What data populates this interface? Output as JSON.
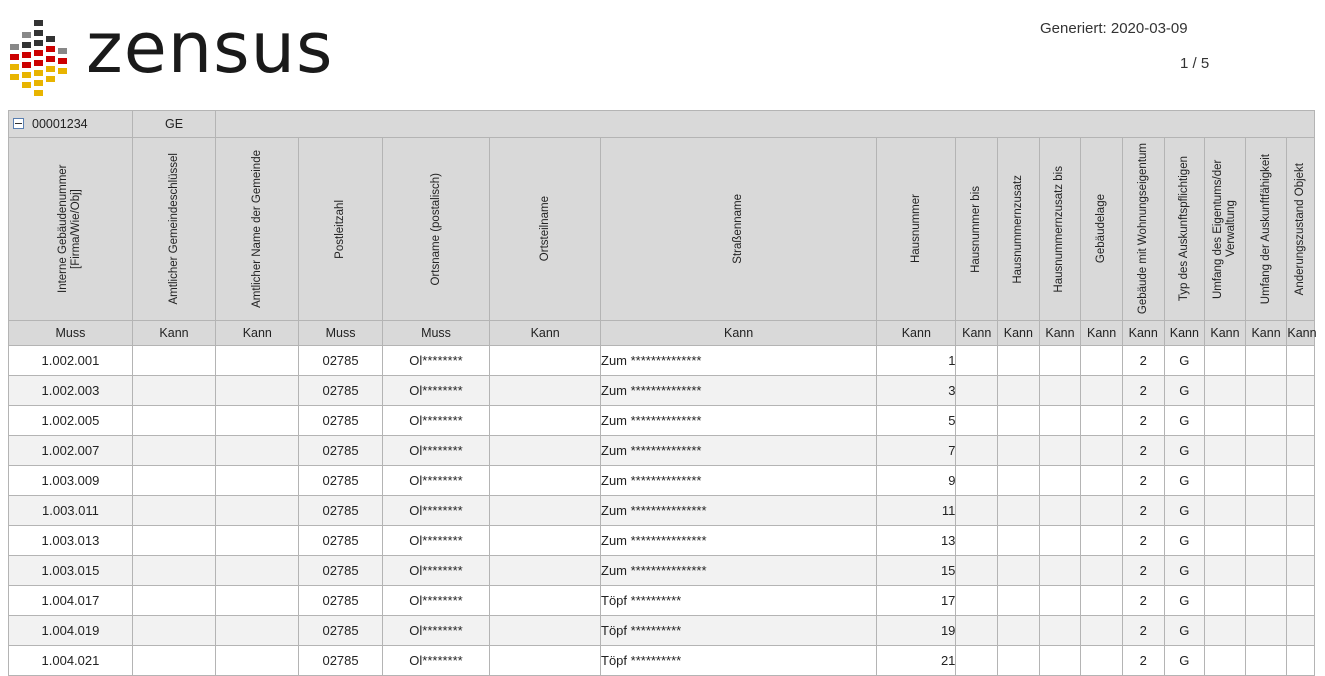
{
  "logo": {
    "word": "zensus"
  },
  "meta": {
    "generated": "Generiert: 2020-03-09",
    "page": "1 / 5"
  },
  "record": {
    "id": "00001234",
    "type": "GE"
  },
  "columns": [
    "Interne Gebäudenummer [Firma/Wie/Obj]",
    "Amtlicher Gemeindeschlüssel",
    "Amtlicher Name der Gemeinde",
    "Postleitzahl",
    "Ortsname (postalisch)",
    "Ortsteilname",
    "Straßenname",
    "Hausnummer",
    "Hausnummer bis",
    "Hausnummernzusatz",
    "Hausnummernzusatz bis",
    "Gebäudelage",
    "Gebäude mit Wohnungseigentum",
    "Typ des Auskunftspflichtigen",
    "Umfang des Eigentums/der Verwaltung",
    "Umfang der Auskunftfähigkeit",
    "Änderungszustand Objekt"
  ],
  "requirements": [
    "Muss",
    "Kann",
    "Kann",
    "Muss",
    "Muss",
    "Kann",
    "Kann",
    "Kann",
    "Kann",
    "Kann",
    "Kann",
    "Kann",
    "Kann",
    "Kann",
    "Kann",
    "Kann",
    "Kann"
  ],
  "rows": [
    {
      "id": "1.002.001",
      "plz": "02785",
      "ort": "Ol********",
      "strasse": "Zum  **************",
      "hnr": "1",
      "wohn": "2",
      "typ": "G"
    },
    {
      "id": "1.002.003",
      "plz": "02785",
      "ort": "Ol********",
      "strasse": "Zum  **************",
      "hnr": "3",
      "wohn": "2",
      "typ": "G"
    },
    {
      "id": "1.002.005",
      "plz": "02785",
      "ort": "Ol********",
      "strasse": "Zum  **************",
      "hnr": "5",
      "wohn": "2",
      "typ": "G"
    },
    {
      "id": "1.002.007",
      "plz": "02785",
      "ort": "Ol********",
      "strasse": "Zum  **************",
      "hnr": "7",
      "wohn": "2",
      "typ": "G"
    },
    {
      "id": "1.003.009",
      "plz": "02785",
      "ort": "Ol********",
      "strasse": "Zum  **************",
      "hnr": "9",
      "wohn": "2",
      "typ": "G"
    },
    {
      "id": "1.003.011",
      "plz": "02785",
      "ort": "Ol********",
      "strasse": "Zum  ***************",
      "hnr": "11",
      "wohn": "2",
      "typ": "G"
    },
    {
      "id": "1.003.013",
      "plz": "02785",
      "ort": "Ol********",
      "strasse": "Zum  ***************",
      "hnr": "13",
      "wohn": "2",
      "typ": "G"
    },
    {
      "id": "1.003.015",
      "plz": "02785",
      "ort": "Ol********",
      "strasse": "Zum  ***************",
      "hnr": "15",
      "wohn": "2",
      "typ": "G"
    },
    {
      "id": "1.004.017",
      "plz": "02785",
      "ort": "Ol********",
      "strasse": "Töpf **********",
      "hnr": "17",
      "wohn": "2",
      "typ": "G"
    },
    {
      "id": "1.004.019",
      "plz": "02785",
      "ort": "Ol********",
      "strasse": "Töpf **********",
      "hnr": "19",
      "wohn": "2",
      "typ": "G"
    },
    {
      "id": "1.004.021",
      "plz": "02785",
      "ort": "Ol********",
      "strasse": "Töpf **********",
      "hnr": "21",
      "wohn": "2",
      "typ": "G"
    }
  ]
}
